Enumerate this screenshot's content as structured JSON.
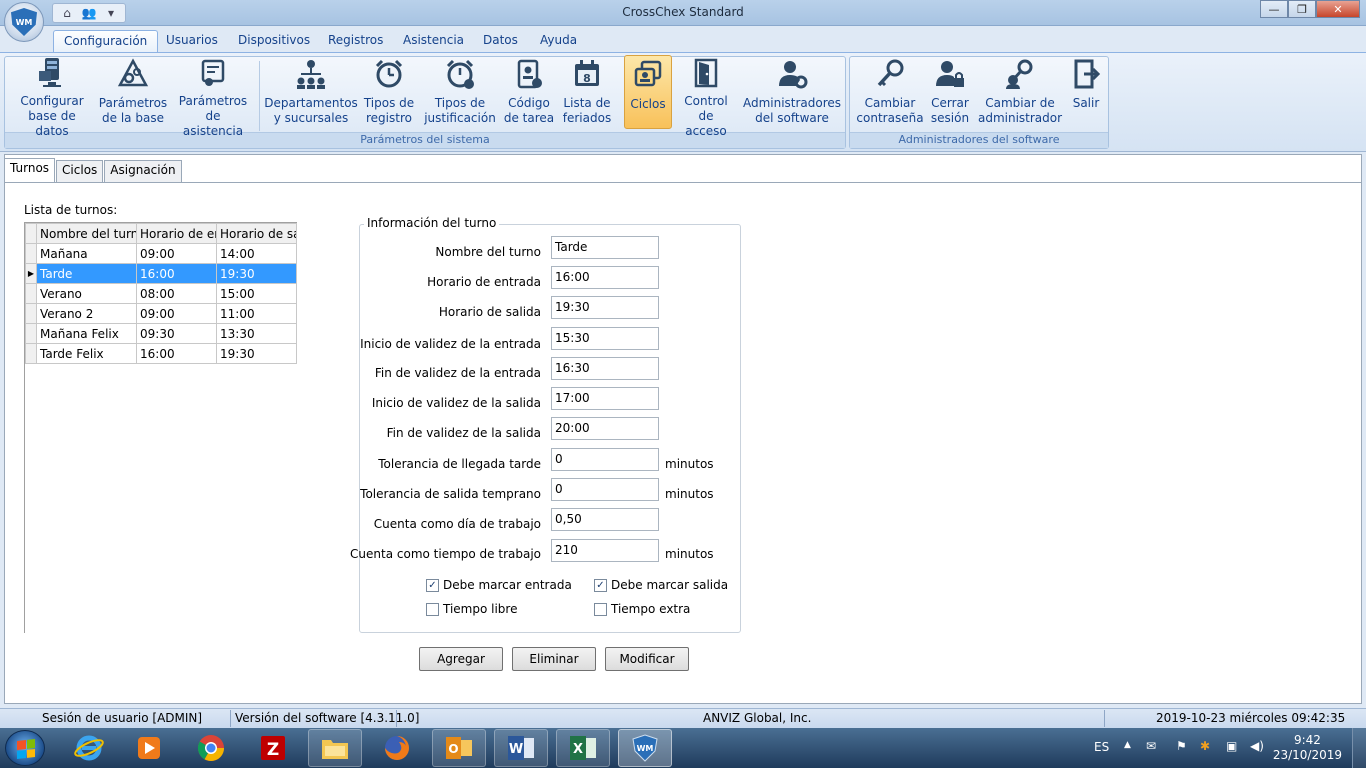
{
  "window": {
    "title": "CrossChex Standard"
  },
  "ribbon_tabs": [
    "Configuración",
    "Usuarios",
    "Dispositivos",
    "Registros",
    "Asistencia",
    "Datos",
    "Ayuda"
  ],
  "ribbon": {
    "group1_label": "Parámetros del sistema",
    "group2_label": "Administradores del software",
    "buttons": [
      {
        "l1": "Configurar",
        "l2": "base de datos"
      },
      {
        "l1": "Parámetros",
        "l2": "de la base"
      },
      {
        "l1": "Parámetros",
        "l2": "de asistencia"
      },
      {
        "l1": "Departamentos",
        "l2": "y sucursales"
      },
      {
        "l1": "Tipos de",
        "l2": "registro"
      },
      {
        "l1": "Tipos de",
        "l2": "justificación"
      },
      {
        "l1": "Código",
        "l2": "de tarea"
      },
      {
        "l1": "Lista de",
        "l2": "feriados"
      },
      {
        "l1": "Ciclos",
        "l2": ""
      },
      {
        "l1": "Control",
        "l2": "de acceso"
      },
      {
        "l1": "Administradores",
        "l2": "del software"
      },
      {
        "l1": "Cambiar",
        "l2": "contraseña"
      },
      {
        "l1": "Cerrar",
        "l2": "sesión"
      },
      {
        "l1": "Cambiar de",
        "l2": "administrador"
      },
      {
        "l1": "Salir",
        "l2": ""
      }
    ]
  },
  "content_tabs": [
    "Turnos",
    "Ciclos",
    "Asignación"
  ],
  "list_label": "Lista de turnos:",
  "grid": {
    "headers": [
      "Nombre del turno",
      "Horario de entrada",
      "Horario de salida"
    ],
    "rows": [
      [
        "Mañana",
        "09:00",
        "14:00"
      ],
      [
        "Tarde",
        "16:00",
        "19:30"
      ],
      [
        "Verano",
        "08:00",
        "15:00"
      ],
      [
        "Verano 2",
        "09:00",
        "11:00"
      ],
      [
        "Mañana Felix",
        "09:30",
        "13:30"
      ],
      [
        "Tarde Felix",
        "16:00",
        "19:30"
      ]
    ],
    "selected_index": 1
  },
  "info": {
    "legend": "Información del turno",
    "fields": [
      {
        "label": "Nombre del turno",
        "value": "Tarde",
        "unit": ""
      },
      {
        "label": "Horario de entrada",
        "value": "16:00",
        "unit": ""
      },
      {
        "label": "Horario de salida",
        "value": "19:30",
        "unit": ""
      },
      {
        "label": "Inicio de validez de la entrada",
        "value": "15:30",
        "unit": ""
      },
      {
        "label": "Fin de validez de la entrada",
        "value": "16:30",
        "unit": ""
      },
      {
        "label": "Inicio de validez de la salida",
        "value": "17:00",
        "unit": ""
      },
      {
        "label": "Fin de validez de la salida",
        "value": "20:00",
        "unit": ""
      },
      {
        "label": "Tolerancia de llegada tarde",
        "value": "0",
        "unit": "minutos"
      },
      {
        "label": "Tolerancia de salida temprano",
        "value": "0",
        "unit": "minutos"
      },
      {
        "label": "Cuenta como día de trabajo",
        "value": "0,50",
        "unit": ""
      },
      {
        "label": "Cuenta como tiempo de trabajo",
        "value": "210",
        "unit": "minutos"
      }
    ],
    "checkboxes": [
      {
        "label": "Debe marcar entrada",
        "checked": true
      },
      {
        "label": "Debe marcar salida",
        "checked": true
      },
      {
        "label": "Tiempo libre",
        "checked": false
      },
      {
        "label": "Tiempo extra",
        "checked": false
      }
    ]
  },
  "actions": {
    "add": "Agregar",
    "delete": "Eliminar",
    "modify": "Modificar"
  },
  "status": {
    "session": "Sesión de usuario  [ADMIN]",
    "version": "Versión del software  [4.3.11.0]",
    "company": "ANVIZ Global, Inc.",
    "datetime": "2019-10-23 miércoles 09:42:35"
  },
  "taskbar": {
    "lang": "ES",
    "time": "9:42",
    "date": "23/10/2019",
    "apps": [
      "internet-explorer-icon",
      "media-player-icon",
      "chrome-icon",
      "filezilla-icon",
      "file-explorer-icon",
      "firefox-icon",
      "outlook-icon",
      "word-icon",
      "excel-icon",
      "crosschex-icon"
    ]
  },
  "colors": {
    "selection": "#3399ff",
    "ribbon_text": "#15428b",
    "selected_ribbon_button": "#f8c15a"
  }
}
